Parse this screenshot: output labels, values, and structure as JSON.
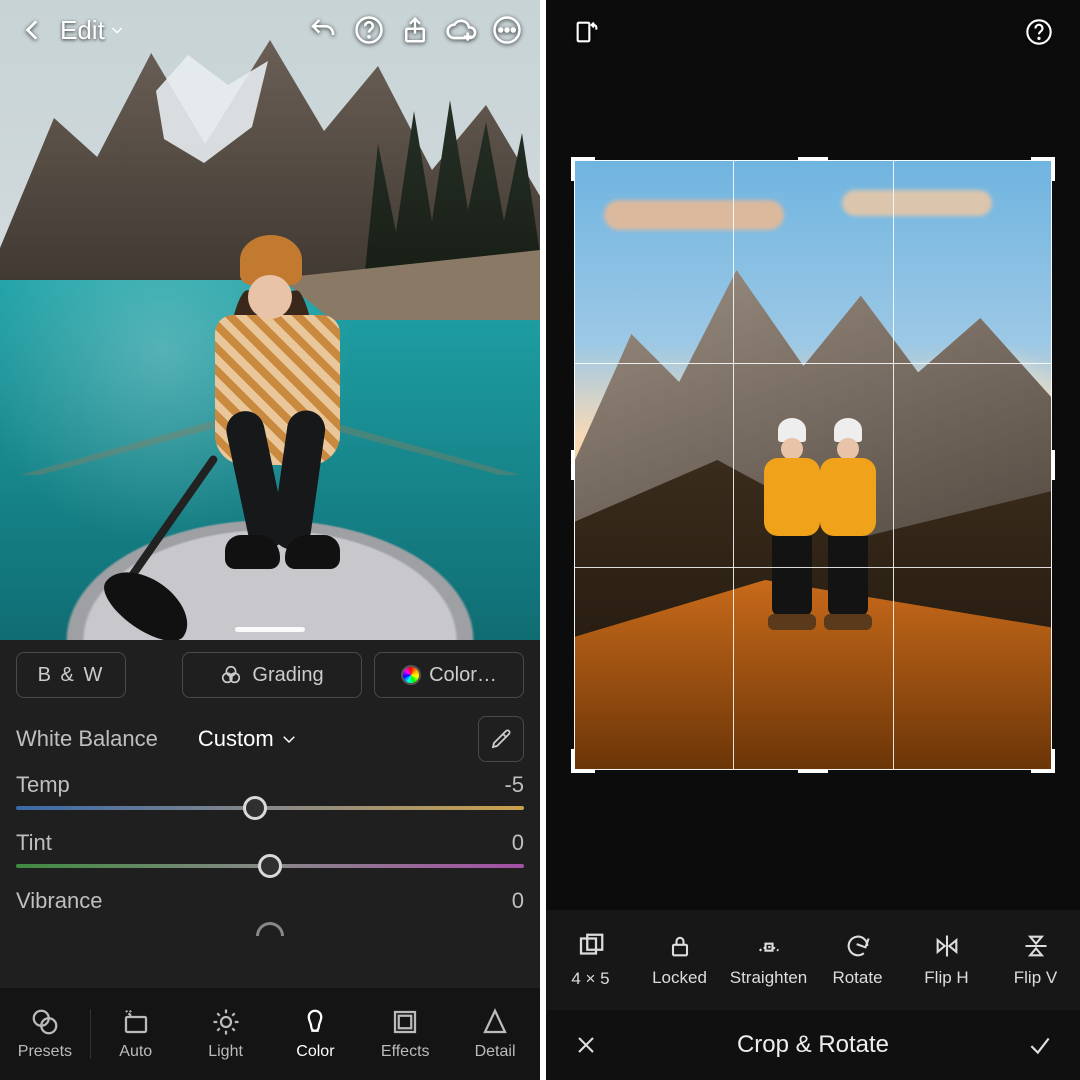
{
  "left": {
    "header": {
      "edit_label": "Edit"
    },
    "pills": {
      "bw": "B & W",
      "grading": "Grading",
      "colormix": "Color…"
    },
    "white_balance": {
      "label": "White Balance",
      "mode": "Custom"
    },
    "sliders": {
      "temp": {
        "label": "Temp",
        "value": "-5",
        "pos": 47
      },
      "tint": {
        "label": "Tint",
        "value": "0",
        "pos": 50
      },
      "vibrance": {
        "label": "Vibrance",
        "value": "0",
        "pos": 50
      }
    },
    "tabs": {
      "presets": "Presets",
      "auto": "Auto",
      "light": "Light",
      "color": "Color",
      "effects": "Effects",
      "detail": "Detail",
      "active": "color"
    }
  },
  "right": {
    "tools": {
      "aspect": "4 × 5",
      "locked": "Locked",
      "straighten": "Straighten",
      "rotate": "Rotate",
      "fliph": "Flip H",
      "flipv": "Flip V"
    },
    "footer": {
      "title": "Crop & Rotate"
    }
  }
}
